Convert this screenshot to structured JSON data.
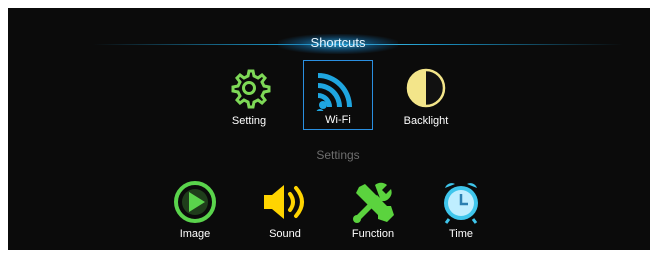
{
  "header": {
    "title": "Shortcuts"
  },
  "top_row": [
    {
      "label": "Setting",
      "icon": "gear-icon",
      "color": "#7ed957",
      "selected": false
    },
    {
      "label": "Wi-Fi",
      "icon": "wifi-icon",
      "color": "#1fa6e0",
      "selected": true
    },
    {
      "label": "Backlight",
      "icon": "backlight-icon",
      "color": "#f3e58a",
      "selected": false
    }
  ],
  "section_label": "Settings",
  "bottom_row": [
    {
      "label": "Image",
      "icon": "play-icon",
      "color": "#5ad44c"
    },
    {
      "label": "Sound",
      "icon": "speaker-icon",
      "color": "#ffd400"
    },
    {
      "label": "Function",
      "icon": "tools-icon",
      "color": "#5bd33e"
    },
    {
      "label": "Time",
      "icon": "alarm-clock-icon",
      "color": "#3fc6ec"
    }
  ]
}
